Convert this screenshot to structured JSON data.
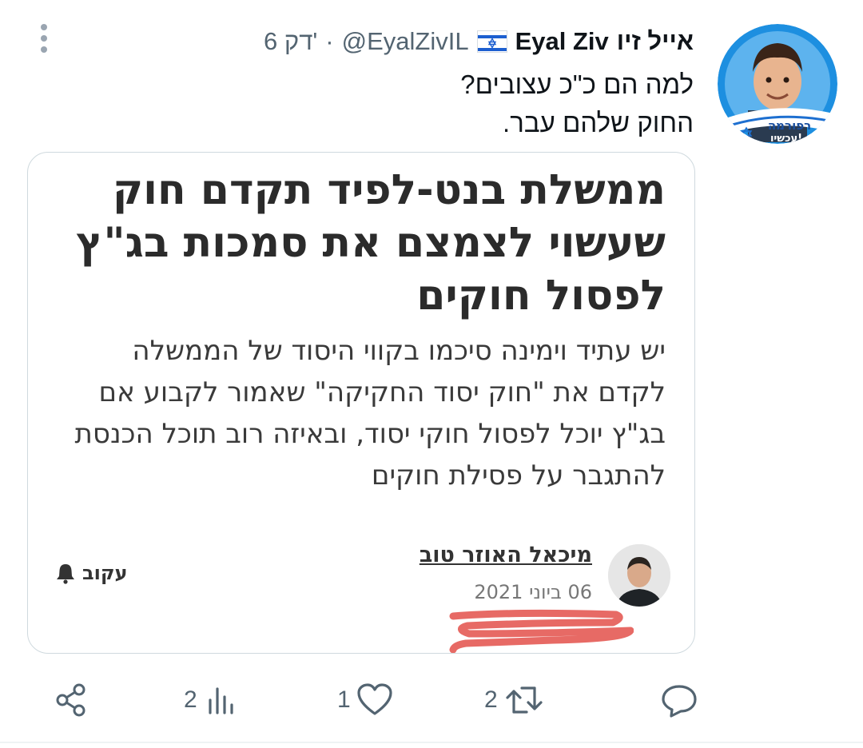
{
  "tweet": {
    "author_name_he": "אייל זיו",
    "author_name_en": "Eyal Ziv",
    "handle": "@EyalZivIL",
    "separator": "·",
    "time": "6 דק'",
    "text_line1": "למה הם כ\"כ עצובים?",
    "text_line2": "החוק שלהם עבר.",
    "avatar_badge": "רפורמה עכשיו!"
  },
  "article": {
    "headline": "ממשלת בנט-לפיד תקדם חוק שעשוי לצמצם את סמכות בג\"ץ לפסול חוקים",
    "summary": "יש עתיד וימינה סיכמו בקווי היסוד של הממשלה לקדם את \"חוק יסוד החקיקה\" שאמור לקבוע אם בג\"ץ יוכל לפסול חוקי יסוד, ובאיזה רוב תוכל הכנסת להתגבר על פסילת חוקים",
    "writer_name": "מיכאל האוזר טוב",
    "date": "06 ביוני 2021",
    "follow_label": "עקוב"
  },
  "actions": {
    "replies": "",
    "retweets": "2",
    "likes": "1",
    "views": "2"
  },
  "icons": {
    "more": "more-vertical-icon",
    "flag": "israel-flag-icon",
    "reply": "reply-icon",
    "retweet": "retweet-icon",
    "like": "heart-icon",
    "views": "views-icon",
    "share": "share-icon",
    "bell": "bell-icon"
  },
  "colors": {
    "text": "#0f1419",
    "secondary": "#536471",
    "border": "#cfd9de",
    "accent_blue": "#1d9bf0",
    "scribble_red": "#e3504a"
  }
}
